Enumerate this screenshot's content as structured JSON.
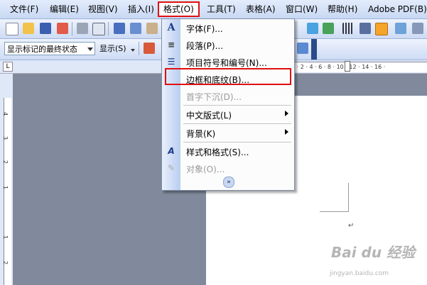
{
  "menubar": {
    "items": [
      "文件(F)",
      "编辑(E)",
      "视图(V)",
      "插入(I)",
      "格式(O)",
      "工具(T)",
      "表格(A)",
      "窗口(W)",
      "帮助(H)",
      "Adobe PDF(B)"
    ]
  },
  "toolbar2": {
    "markup_combo": "显示标记的最终状态",
    "show_button": "显示(S)"
  },
  "format_menu": {
    "items": [
      {
        "label": "字体(F)...",
        "icon": "font-a-icon",
        "enabled": true
      },
      {
        "label": "段落(P)...",
        "icon": "paragraph-icon",
        "enabled": true
      },
      {
        "label": "项目符号和编号(N)...",
        "icon": "bullets-icon",
        "enabled": true
      },
      {
        "label": "边框和底纹(B)...",
        "icon": "",
        "enabled": true,
        "highlighted": true
      },
      {
        "label": "首字下沉(D)...",
        "icon": "",
        "enabled": false
      },
      {
        "label": "中文版式(L)",
        "icon": "",
        "enabled": true,
        "submenu": true
      },
      {
        "label": "背景(K)",
        "icon": "",
        "enabled": true,
        "submenu": true
      },
      {
        "label": "样式和格式(S)...",
        "icon": "styles-icon",
        "enabled": true
      },
      {
        "label": "对象(O)...",
        "icon": "object-icon",
        "enabled": false
      }
    ]
  },
  "ruler": {
    "tab_selector": "L",
    "h_numbers": "2 · 2 · 4 · 6 · 8 · 10 · 12 · 14 · 16 ·",
    "v_numbers": [
      "4",
      "3",
      "2",
      "1",
      "1",
      "2"
    ]
  },
  "watermark": {
    "logo": "Bai du 经验",
    "url": "jingyan.baidu.com"
  },
  "colors": {
    "highlight": "#e01010",
    "menubar": "#d6e3f8"
  }
}
